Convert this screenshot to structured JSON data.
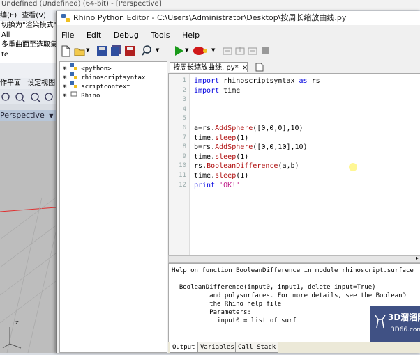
{
  "background_app": {
    "title": "Undefined (Undefined) (64-bit) - [Perspective]",
    "menu_items": [
      "编(E)",
      "查看(V)"
    ],
    "command_lines": [
      "切换为\"渲染模式\"",
      "All",
      "多重曲面至选取集",
      "te"
    ],
    "toolbar_tabs": [
      "作平面",
      "设定视图"
    ],
    "viewport_label": "Perspective",
    "axis_label": "z"
  },
  "window": {
    "title": "Rhino Python Editor - C:\\Users\\Administrator\\Desktop\\按周长缩放曲线.py"
  },
  "menu": {
    "items": [
      "File",
      "Edit",
      "Debug",
      "Tools",
      "Help"
    ]
  },
  "toolbar": {
    "icons": [
      "new-file-icon",
      "open-folder-icon",
      "save-icon",
      "save-all-icon",
      "save-as-icon",
      "search-icon",
      "run-icon",
      "debug-icon",
      "step-into-icon",
      "step-over-icon",
      "step-out-icon",
      "stop-icon"
    ]
  },
  "tree": {
    "items": [
      "<python>",
      "rhinoscriptsyntax",
      "scriptcontext",
      "Rhino"
    ]
  },
  "editor": {
    "tab_label": "按周长缩放曲线. py*",
    "lines": [
      {
        "n": "1",
        "text": "import rhinoscriptsyntax as rs"
      },
      {
        "n": "2",
        "text": "import time"
      },
      {
        "n": "3",
        "text": ""
      },
      {
        "n": "4",
        "text": ""
      },
      {
        "n": "5",
        "text": ""
      },
      {
        "n": "6",
        "text": "a=rs.AddSphere([0,0,0],10)"
      },
      {
        "n": "7",
        "text": "time.sleep(1)"
      },
      {
        "n": "8",
        "text": "b=rs.AddSphere([0,0,10],10)"
      },
      {
        "n": "9",
        "text": "time.sleep(1)"
      },
      {
        "n": "10",
        "text": "rs.BooleanDifference(a,b)"
      },
      {
        "n": "11",
        "text": "time.sleep(1)"
      },
      {
        "n": "12",
        "text": "print 'OK!'"
      }
    ]
  },
  "help": {
    "lines": [
      "Help on function BooleanDifference in module rhinoscript.surface",
      "",
      "  BooleanDifference(input0, input1, delete_input=True)",
      "          and polysurfaces. For more details, see the BooleanD",
      "          the Rhino help file",
      "          Parameters:",
      "            input0 = list of surf"
    ]
  },
  "bottom_tabs": [
    "Output",
    "Variables",
    "Call Stack"
  ],
  "watermark": {
    "text": "3D溜溜网",
    "sub": "3D66.com"
  },
  "colors": {
    "keyword": "#0000e0",
    "function": "#b01010",
    "string": "#c0208a",
    "run_green": "#1a9a1a"
  }
}
